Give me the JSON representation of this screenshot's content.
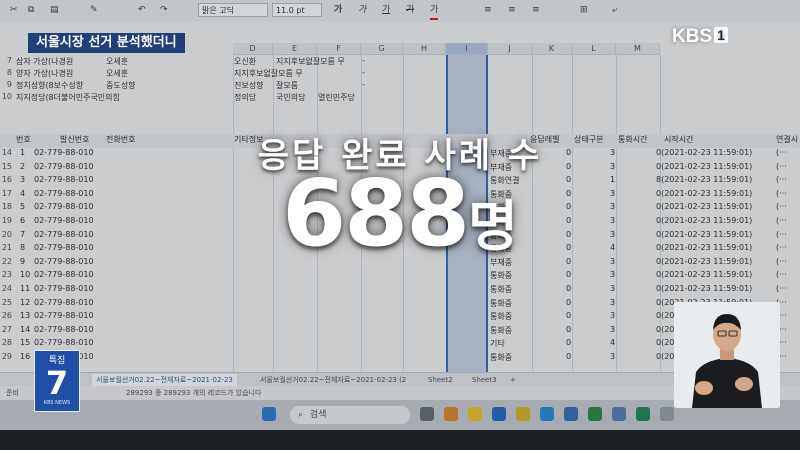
{
  "caption": "서울시장 선거 분석했더니",
  "broadcaster": {
    "name": "KBS",
    "channel": "1"
  },
  "badge": {
    "top": "특집",
    "number": "7",
    "bottom": "KBS NEWS"
  },
  "overlay": {
    "title": "응답 완료 사례 수",
    "count": "688",
    "unit": "명"
  },
  "toolbar": {
    "font_name": "맑은 고딕",
    "font_size": "11.0",
    "unit": "pt"
  },
  "columns": [
    "D",
    "E",
    "F",
    "G",
    "H",
    "I",
    "J",
    "K",
    "L",
    "M"
  ],
  "top_rows": [
    {
      "num": "7",
      "a": "삼자 가상(나경원",
      "b": "오세훈",
      "d": "오신환",
      "e": "지지후보없잘모름 무",
      "f": "-"
    },
    {
      "num": "8",
      "a": "양자 가상(나경원",
      "b": "오세훈",
      "d": "지지후보없잘모름 무",
      "e": "",
      "f": "-"
    },
    {
      "num": "9",
      "a": "정치성향(8보수성향",
      "b": "중도성향",
      "d": "진보성향",
      "e": "잘모름",
      "f": "-"
    },
    {
      "num": "10",
      "a": "지지정당(8더불어민주국민의힘",
      "b": "",
      "d": "정의당",
      "e": "국민의당",
      "f": "열린민주당"
    }
  ],
  "table_headers": {
    "num": "번호",
    "phone": "발신번호",
    "contact": "전화번호",
    "extra": "기타정보",
    "status": "응답레벨",
    "state": "상태구분",
    "call": "통화시간",
    "start": "시작시간",
    "conn": "연결시"
  },
  "rows": [
    {
      "num": "14",
      "id": "1",
      "phone": "02-779-88-010",
      "status": "부재중",
      "code": "0",
      "st": "3",
      "start": "0(2021-02-23 11:59:01)"
    },
    {
      "num": "15",
      "id": "2",
      "phone": "02-779-88-010",
      "status": "부재중",
      "code": "0",
      "st": "3",
      "start": "0(2021-02-23 11:59:01)"
    },
    {
      "num": "16",
      "id": "3",
      "phone": "02-779-88-010",
      "status": "통화연결",
      "code": "0",
      "st": "1",
      "start": "8(2021-02-23 11:59:01)"
    },
    {
      "num": "17",
      "id": "4",
      "phone": "02-779-88-010",
      "status": "통화중",
      "code": "0",
      "st": "3",
      "start": "0(2021-02-23 11:59:01)"
    },
    {
      "num": "18",
      "id": "5",
      "phone": "02-779-88-010",
      "status": "통화중",
      "code": "0",
      "st": "3",
      "start": "0(2021-02-23 11:59:01)"
    },
    {
      "num": "19",
      "id": "6",
      "phone": "02-779-88-010",
      "status": "통화중",
      "code": "0",
      "st": "3",
      "start": "0(2021-02-23 11:59:01)"
    },
    {
      "num": "20",
      "id": "7",
      "phone": "02-779-88-010",
      "status": "통화중",
      "code": "0",
      "st": "3",
      "start": "0(2021-02-23 11:59:01)"
    },
    {
      "num": "21",
      "id": "8",
      "phone": "02-779-88-010",
      "status": "통화중",
      "code": "0",
      "st": "4",
      "start": "0(2021-02-23 11:59:01)"
    },
    {
      "num": "22",
      "id": "9",
      "phone": "02-779-88-010",
      "status": "부재중",
      "code": "0",
      "st": "3",
      "start": "0(2021-02-23 11:59:01)"
    },
    {
      "num": "23",
      "id": "10",
      "phone": "02-779-88-010",
      "status": "통화중",
      "code": "0",
      "st": "3",
      "start": "0(2021-02-23 11:59:01)"
    },
    {
      "num": "24",
      "id": "11",
      "phone": "02-779-88-010",
      "status": "통화중",
      "code": "0",
      "st": "3",
      "start": "0(2021-02-23 11:59:01)"
    },
    {
      "num": "25",
      "id": "12",
      "phone": "02-779-88-010",
      "status": "통화중",
      "code": "0",
      "st": "3",
      "start": "0(2021-02-23 11:59:01)"
    },
    {
      "num": "26",
      "id": "13",
      "phone": "02-779-88-010",
      "status": "통화중",
      "code": "0",
      "st": "3",
      "start": "0(2021-02-23 11:59:01)"
    },
    {
      "num": "27",
      "id": "14",
      "phone": "02-779-88-010",
      "status": "통화중",
      "code": "0",
      "st": "3",
      "start": "0(2021-02-23 11:59:01)"
    },
    {
      "num": "28",
      "id": "15",
      "phone": "02-779-88-010",
      "status": "기타",
      "code": "0",
      "st": "4",
      "start": "0(2021-02-23 11:59:01)"
    },
    {
      "num": "29",
      "id": "16",
      "phone": "02-779-88-010",
      "status": "통화중",
      "code": "0",
      "st": "3",
      "start": "0(2021-02-23 11:59:01)"
    }
  ],
  "tabs": [
    "서울보궐선거02.22~전체자료~2021-02-23",
    "서울보궐선거02.22~전체자료~2021-02-23 (2",
    "Sheet2",
    "Sheet3",
    "+"
  ],
  "status_bar": {
    "left": "준비",
    "middle": "289293 중 289293 개의 레코드가 있습니다"
  },
  "taskbar": {
    "search": "검색"
  }
}
